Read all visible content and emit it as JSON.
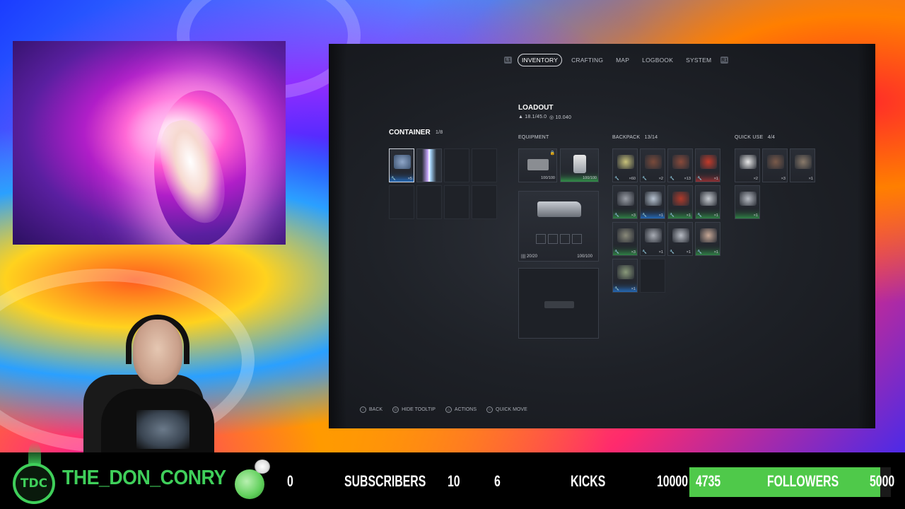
{
  "game": {
    "nav": {
      "left_key": "L1",
      "right_key": "R1",
      "tabs": [
        {
          "label": "INVENTORY",
          "active": true
        },
        {
          "label": "CRAFTING",
          "active": false
        },
        {
          "label": "MAP",
          "active": false
        },
        {
          "label": "LOGBOOK",
          "active": false
        },
        {
          "label": "SYSTEM",
          "active": false
        }
      ]
    },
    "container": {
      "title": "CONTAINER",
      "count": "1/8",
      "slot0_count": "×5"
    },
    "loadout": {
      "title": "LOADOUT",
      "weight": "18.1/45.0",
      "credits": "10.040"
    },
    "equipment": {
      "label": "EQUIPMENT",
      "slot1_value": "100/100",
      "slot2_value": "100/100",
      "weapon_ammo": "20/20",
      "weapon_durability": "100/100"
    },
    "backpack": {
      "label": "BACKPACK",
      "count": "13/14",
      "counts": [
        "×60",
        "×2",
        "×13",
        "×1",
        "×3",
        "×1",
        "×1",
        "×1",
        "×3",
        "×1",
        "×1",
        "×1",
        "×1"
      ]
    },
    "quick_use": {
      "label": "QUICK USE",
      "count": "4/4",
      "counts": [
        "×2",
        "×3",
        "×1",
        "×1"
      ]
    },
    "hints": [
      {
        "glyph": "○",
        "label": "BACK"
      },
      {
        "glyph": "⊡",
        "label": "HIDE TOOLTIP"
      },
      {
        "glyph": "△",
        "label": "ACTIONS"
      },
      {
        "glyph": "□",
        "label": "QUICK MOVE"
      }
    ]
  },
  "stream": {
    "logo_text": "TDC",
    "channel_name": "THE_DON_CONRY",
    "subs_current": "0",
    "subs_label": "SUBSCRIBERS",
    "subs_goal": "10",
    "kicks_current": "6",
    "kicks_label": "KICKS",
    "kicks_goal": "10000",
    "followers_current": "4735",
    "followers_label": "FOLLOWERS",
    "followers_goal": "5000",
    "followers_progress": 0.947,
    "accent_color": "#3fcf5a"
  }
}
